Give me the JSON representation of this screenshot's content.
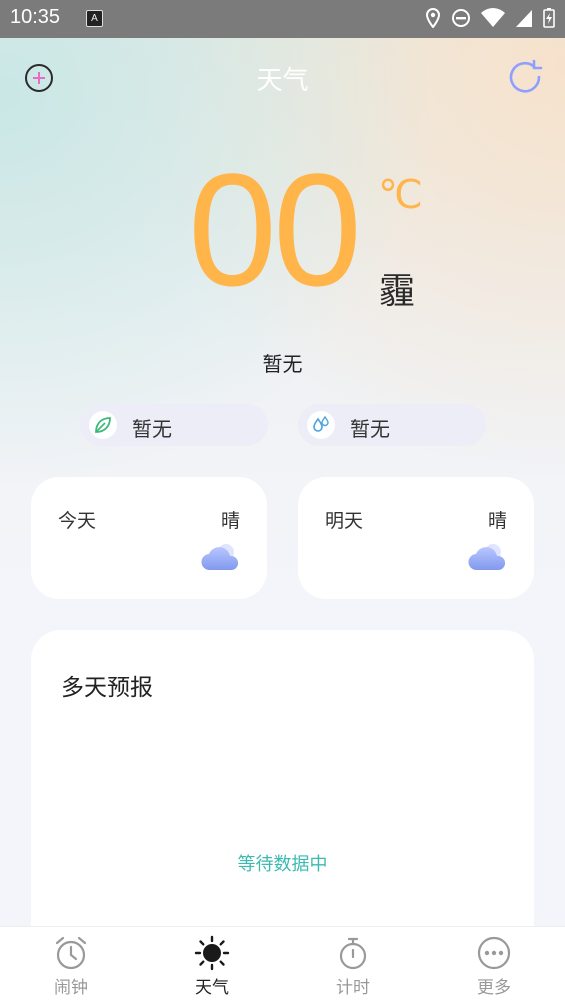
{
  "status_bar": {
    "time": "10:35",
    "badge": "A",
    "icons": [
      "location-icon",
      "dnd-icon",
      "wifi-icon",
      "signal-icon",
      "battery-icon"
    ]
  },
  "header": {
    "title": "天气",
    "add_icon": "add-city-icon",
    "refresh_icon": "refresh-icon"
  },
  "current": {
    "temperature": "00",
    "unit": "℃",
    "condition": "霾",
    "air_quality": "暂无",
    "indicators": [
      {
        "icon": "leaf-icon",
        "value": "暂无"
      },
      {
        "icon": "humidity-icon",
        "value": "暂无"
      }
    ]
  },
  "days": [
    {
      "name": "今天",
      "weather": "晴",
      "icon": "cloud-icon"
    },
    {
      "name": "明天",
      "weather": "晴",
      "icon": "cloud-icon"
    }
  ],
  "forecast": {
    "title": "多天预报",
    "status": "等待数据中"
  },
  "tabs": [
    {
      "label": "闹钟",
      "icon": "alarm-clock-icon",
      "active": false
    },
    {
      "label": "天气",
      "icon": "sun-icon",
      "active": true
    },
    {
      "label": "计时",
      "icon": "stopwatch-icon",
      "active": false
    },
    {
      "label": "更多",
      "icon": "more-icon",
      "active": false
    }
  ],
  "colors": {
    "accent_temp": "#ffb54a",
    "accent_status": "#3cbab0",
    "refresh": "#8ea0ff"
  }
}
